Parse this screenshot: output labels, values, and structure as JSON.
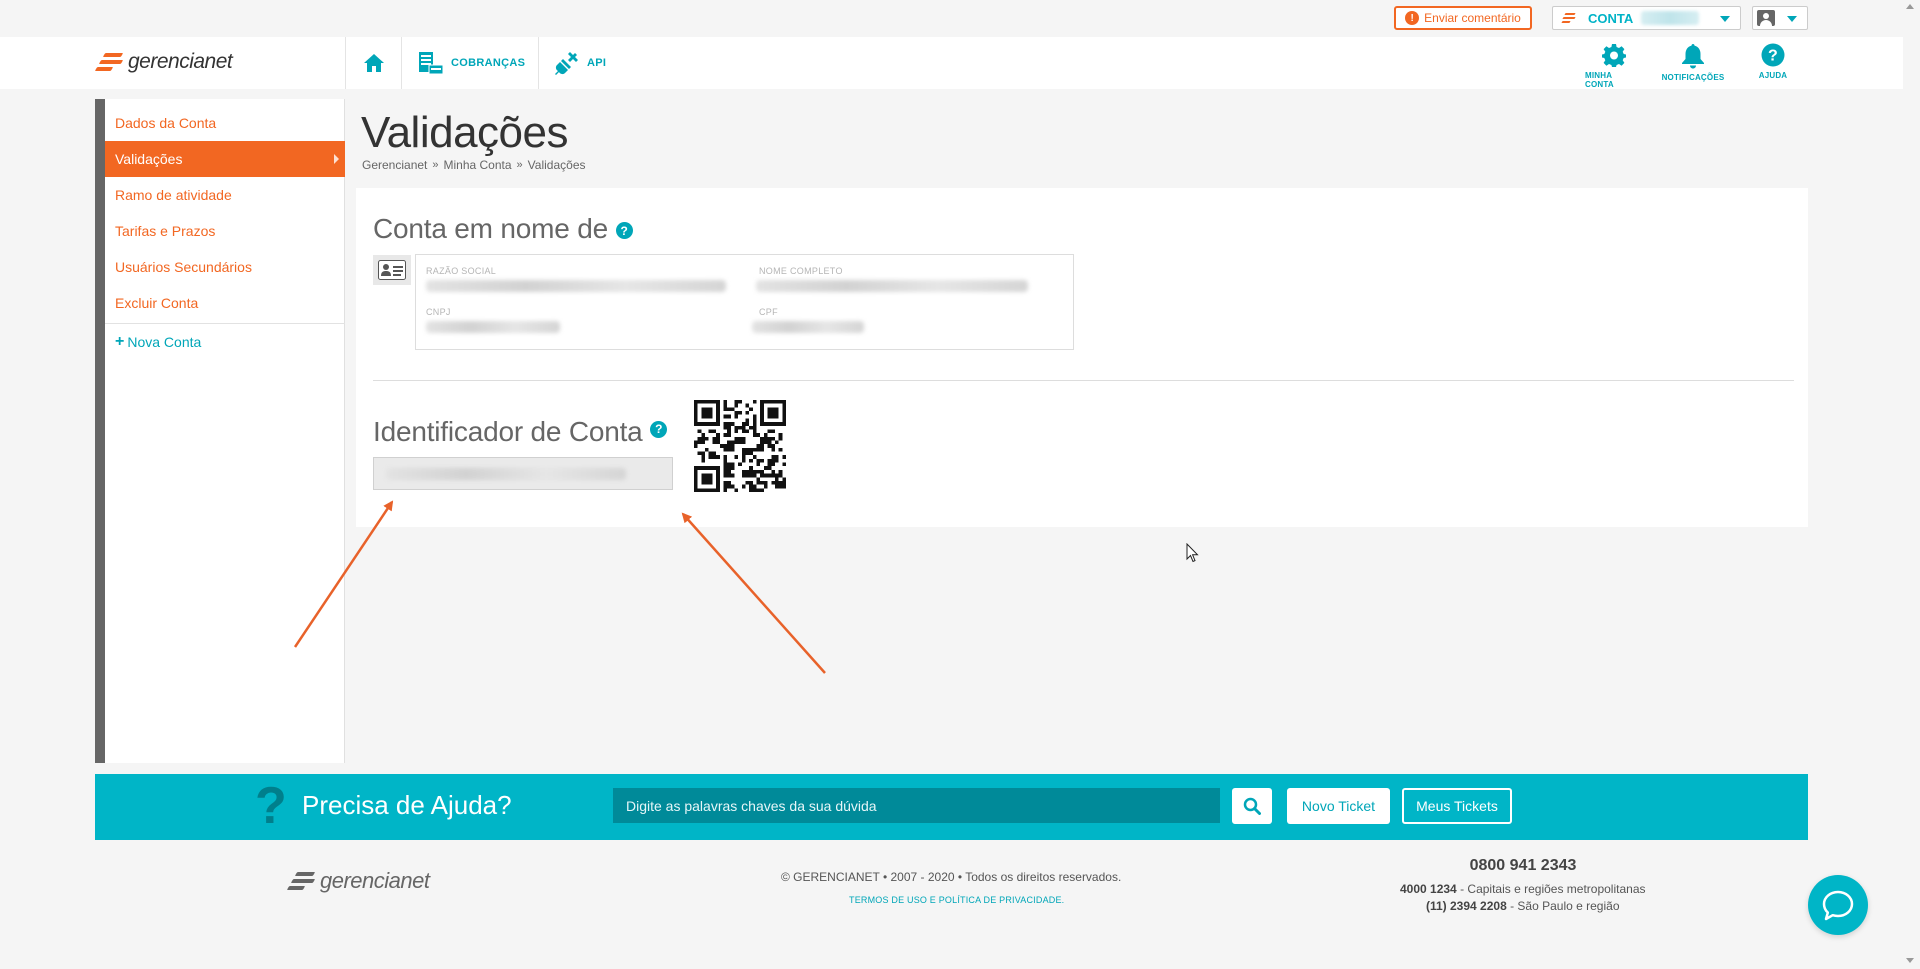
{
  "topbar": {
    "feedback_label": "Enviar comentário",
    "account_label": "CONTA"
  },
  "nav": {
    "brand": "gerencianet",
    "items": [
      {
        "label": "COBRANÇAS",
        "icon": "invoice-icon"
      },
      {
        "label": "API",
        "icon": "plug-icon"
      }
    ],
    "right_items": [
      {
        "label": "MINHA CONTA",
        "icon": "gear-icon"
      },
      {
        "label": "NOTIFICAÇÕES",
        "icon": "bell-icon"
      },
      {
        "label": "AJUDA",
        "icon": "question-circle-icon"
      }
    ]
  },
  "sidebar": {
    "items": [
      {
        "label": "Dados da Conta",
        "active": false
      },
      {
        "label": "Validações",
        "active": true
      },
      {
        "label": "Ramo de atividade",
        "active": false
      },
      {
        "label": "Tarifas e Prazos",
        "active": false
      },
      {
        "label": "Usuários Secundários",
        "active": false
      },
      {
        "label": "Excluir Conta",
        "active": false
      }
    ],
    "new_account": "Nova Conta"
  },
  "page": {
    "title": "Validações",
    "breadcrumb": [
      "Gerencianet",
      "Minha Conta",
      "Validações"
    ],
    "breadcrumb_sep": "»"
  },
  "account_owner": {
    "title": "Conta em nome de",
    "fields": {
      "razao_social_label": "RAZÃO SOCIAL",
      "nome_completo_label": "NOME COMPLETO",
      "cnpj_label": "CNPJ",
      "cpf_label": "CPF"
    }
  },
  "identifier": {
    "title": "Identificador de Conta"
  },
  "help_bar": {
    "title": "Precisa de Ajuda?",
    "search_placeholder": "Digite as palavras chaves da sua dúvida",
    "new_ticket": "Novo Ticket",
    "my_tickets": "Meus Tickets"
  },
  "footer": {
    "brand": "gerencianet",
    "copyright": "© GERENCIANET • 2007 - 2020 • Todos os direitos reservados.",
    "terms": "TERMOS DE USO E POLÍTICA DE PRIVACIDADE.",
    "phone_main": "0800 941 2343",
    "phone_capitals_number": "4000 1234",
    "phone_capitals_text": " - Capitais e regiões metropolitanas",
    "phone_sp_number": "(11) 2394 2208",
    "phone_sp_text": " - São Paulo e região"
  },
  "colors": {
    "brand_orange": "#f26722",
    "brand_teal": "#00b5c7"
  }
}
